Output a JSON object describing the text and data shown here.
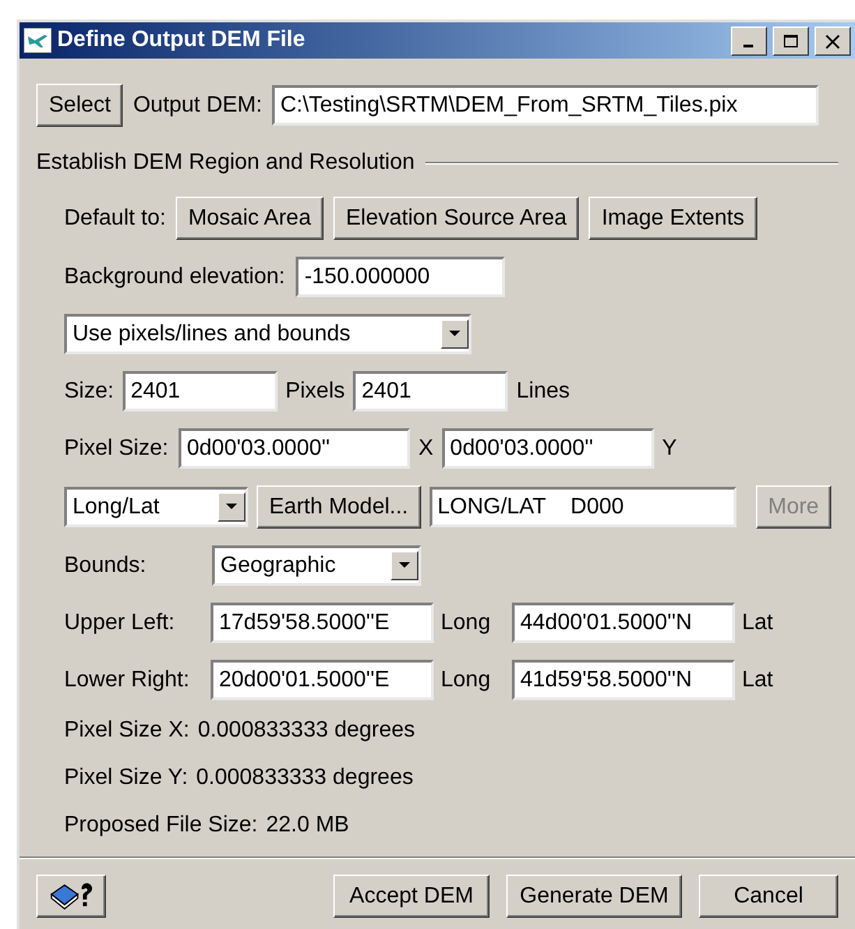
{
  "window": {
    "title": "Define Output DEM File"
  },
  "output": {
    "button": "Select",
    "label": "Output DEM:",
    "value": "C:\\Testing\\SRTM\\DEM_From_SRTM_Tiles.pix"
  },
  "group": {
    "title": "Establish DEM Region and Resolution"
  },
  "default_to": {
    "label": "Default to:",
    "buttons": [
      "Mosaic Area",
      "Elevation Source Area",
      "Image Extents"
    ]
  },
  "background": {
    "label": "Background elevation:",
    "value": "-150.000000"
  },
  "mode": {
    "value": "Use pixels/lines and bounds"
  },
  "size": {
    "label": "Size:",
    "pixels": "2401",
    "pixels_label": "Pixels",
    "lines": "2401",
    "lines_label": "Lines"
  },
  "pixel_size": {
    "label": "Pixel Size:",
    "x": "0d00'03.0000''",
    "x_label": "X",
    "y": "0d00'03.0000''",
    "y_label": "Y"
  },
  "projection": {
    "value": "Long/Lat",
    "earth_button": "Earth Model...",
    "earth_value": "LONG/LAT    D000",
    "more_button": "More",
    "more_disabled": true
  },
  "bounds": {
    "label": "Bounds:",
    "value": "Geographic"
  },
  "corners": [
    {
      "label": "Upper Left:",
      "x": "17d59'58.5000''E",
      "x_label": "Long",
      "y": "44d00'01.5000''N",
      "y_label": "Lat"
    },
    {
      "label": "Lower Right:",
      "x": "20d00'01.5000''E",
      "x_label": "Long",
      "y": "41d59'58.5000''N",
      "y_label": "Lat"
    }
  ],
  "info": [
    {
      "label": "Pixel Size X:",
      "value": "0.000833333 degrees"
    },
    {
      "label": "Pixel Size Y:",
      "value": "0.000833333 degrees"
    },
    {
      "label": "Proposed File Size:",
      "value": "22.0 MB"
    }
  ],
  "buttons": [
    "Accept DEM",
    "Generate DEM",
    "Cancel"
  ]
}
